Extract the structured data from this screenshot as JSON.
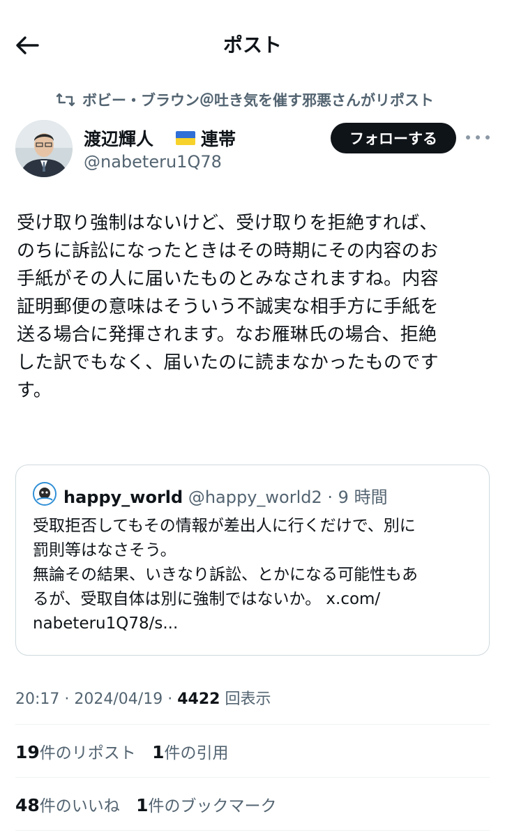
{
  "header": {
    "title": "ポスト",
    "back_icon": "arrow-left-icon"
  },
  "repost": {
    "text": "ボビー・ブラウン＠吐き気を催す邪悪さんがリポスト",
    "icon": "repost-icon"
  },
  "author": {
    "name": "渡辺輝人",
    "name_suffix": "連帯",
    "flag_colors": [
      "#2f6fd6",
      "#f7d22a"
    ],
    "handle": "@nabeteru1Q78",
    "follow_label": "フォローする"
  },
  "post": {
    "lines": [
      "受け取り強制はないけど、受け取りを拒絶すれば、",
      "のちに訴訟になったときはその時期にその内容のお",
      "手紙がその人に届いたものとみなされますね。内容",
      "証明郵便の意味はそういう不誠実な相手方に手紙を",
      "送る場合に発揮されます。なお雁琳氏の場合、拒絶",
      "した訳でもなく、届いたのに読まなかったものです",
      "す。"
    ]
  },
  "quote": {
    "name": "happy_world",
    "handle": "@happy_world2",
    "time": "· 9 時間",
    "lines": [
      "受取拒否してもその情報が差出人に行くだけで、別に",
      "罰則等はなさそう。",
      "無論その結果、いきなり訴訟、とかになる可能性もあ",
      "るが、受取自体は別に強制ではないか。 x.com/",
      "nabeteru1Q78/s..."
    ]
  },
  "meta": {
    "time": "20:17",
    "date": "2024/04/19",
    "views": "4422",
    "views_label": "回表示"
  },
  "stats": {
    "reposts": "19",
    "reposts_label": "件のリポスト",
    "quotes": "1",
    "quotes_label": "件の引用",
    "likes": "48",
    "likes_label": "件のいいね",
    "bookmarks": "1",
    "bookmarks_label": "件のブックマーク"
  }
}
